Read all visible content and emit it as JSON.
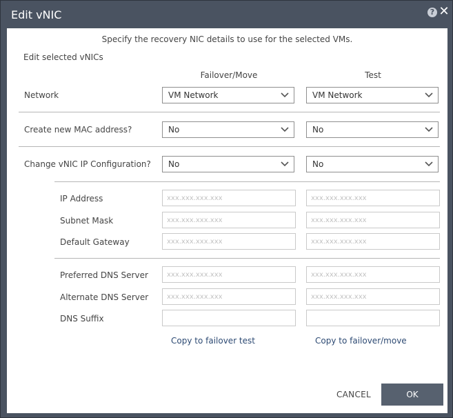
{
  "window": {
    "title": "Edit vNIC",
    "help_symbol": "?",
    "close_symbol": "✕"
  },
  "instruction": "Specify the recovery NIC details to use for the selected VMs.",
  "section_label": "Edit selected vNICs",
  "columns": {
    "failover": "Failover/Move",
    "test": "Test"
  },
  "network": {
    "label": "Network",
    "failover_value": "VM Network",
    "test_value": "VM Network"
  },
  "mac": {
    "label": "Create new MAC address?",
    "failover_value": "No",
    "test_value": "No"
  },
  "ip_config": {
    "label": "Change vNIC IP Configuration?",
    "failover_value": "No",
    "test_value": "No"
  },
  "fields": {
    "ip_address": {
      "label": "IP Address",
      "placeholder": "xxx.xxx.xxx.xxx"
    },
    "subnet_mask": {
      "label": "Subnet Mask",
      "placeholder": "xxx.xxx.xxx.xxx"
    },
    "default_gateway": {
      "label": "Default Gateway",
      "placeholder": "xxx.xxx.xxx.xxx"
    },
    "preferred_dns": {
      "label": "Preferred DNS Server",
      "placeholder": "xxx.xxx.xxx.xxx"
    },
    "alternate_dns": {
      "label": "Alternate DNS Server",
      "placeholder": "xxx.xxx.xxx.xxx"
    },
    "dns_suffix": {
      "label": "DNS Suffix",
      "placeholder": ""
    }
  },
  "links": {
    "copy_to_test": "Copy to failover test",
    "copy_to_failover": "Copy to failover/move"
  },
  "buttons": {
    "cancel": "CANCEL",
    "ok": "OK"
  },
  "colors": {
    "titlebar": "#4a5361",
    "ok_button": "#57616f",
    "link": "#2d4a73"
  }
}
